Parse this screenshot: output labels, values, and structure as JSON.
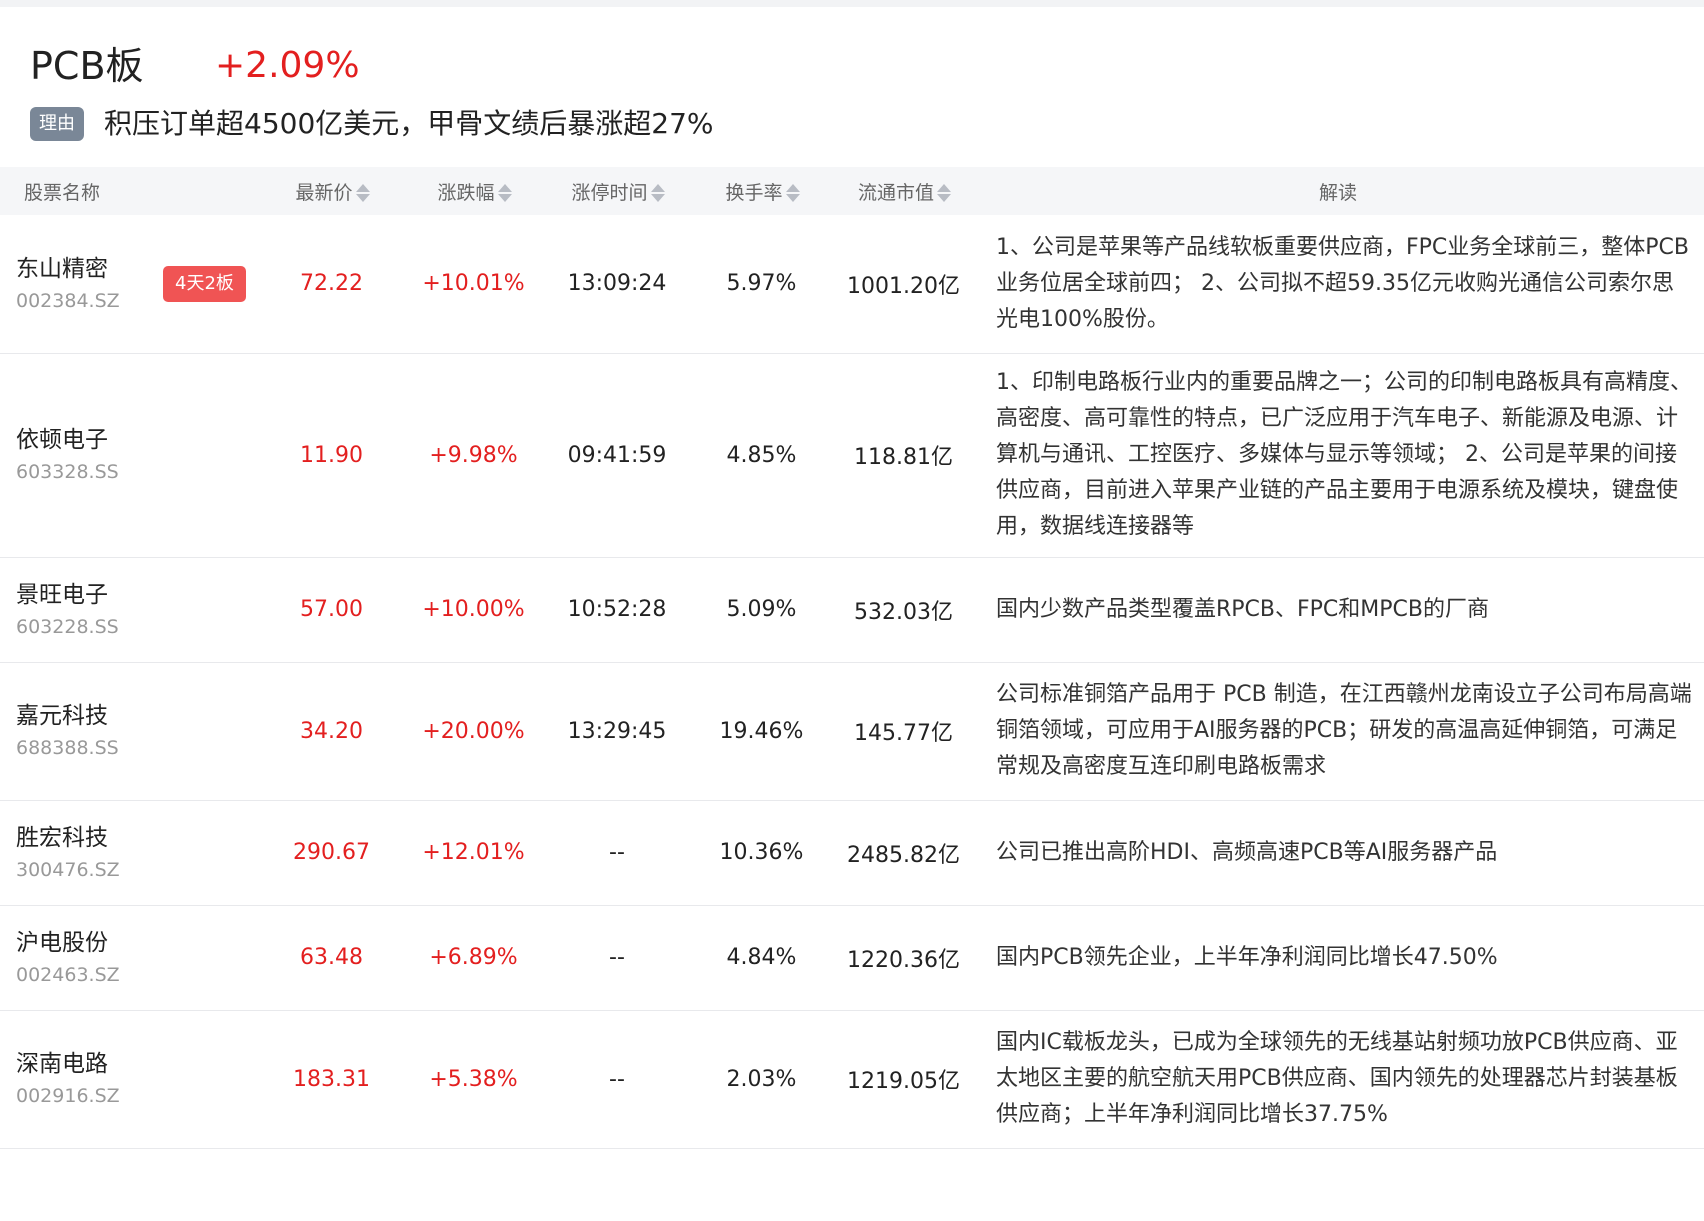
{
  "header": {
    "title": "PCB板",
    "change": "+2.09%",
    "reason_label": "理由",
    "reason_text": "积压订单超4500亿美元，甲骨文绩后暴涨超27%"
  },
  "table": {
    "columns": {
      "name": "股票名称",
      "price": "最新价",
      "change": "涨跌幅",
      "limit_time": "涨停时间",
      "turnover": "换手率",
      "float_cap": "流通市值",
      "interp": "解读"
    },
    "rows": [
      {
        "name": "东山精密",
        "code": "002384.SZ",
        "tag": "4天2板",
        "price": "72.22",
        "change": "+10.01%",
        "limit_time": "13:09:24",
        "turnover": "5.97%",
        "float_cap": "1001.20亿",
        "interp": "1、公司是苹果等产品线软板重要供应商，FPC业务全球前三，整体PCB业务位居全球前四； 2、公司拟不超59.35亿元收购光通信公司索尔思光电100%股份。"
      },
      {
        "name": "依顿电子",
        "code": "603328.SS",
        "tag": "",
        "price": "11.90",
        "change": "+9.98%",
        "limit_time": "09:41:59",
        "turnover": "4.85%",
        "float_cap": "118.81亿",
        "interp": "1、印制电路板行业内的重要品牌之一；公司的印制电路板具有高精度、高密度、高可靠性的特点，已广泛应用于汽车电子、新能源及电源、计算机与通讯、工控医疗、多媒体与显示等领域； 2、公司是苹果的间接供应商，目前进入苹果产业链的产品主要用于电源系统及模块，键盘使用，数据线连接器等"
      },
      {
        "name": "景旺电子",
        "code": "603228.SS",
        "tag": "",
        "price": "57.00",
        "change": "+10.00%",
        "limit_time": "10:52:28",
        "turnover": "5.09%",
        "float_cap": "532.03亿",
        "interp": "国内少数产品类型覆盖RPCB、FPC和MPCB的厂商"
      },
      {
        "name": "嘉元科技",
        "code": "688388.SS",
        "tag": "",
        "price": "34.20",
        "change": "+20.00%",
        "limit_time": "13:29:45",
        "turnover": "19.46%",
        "float_cap": "145.77亿",
        "interp": "公司标准铜箔产品用于 PCB 制造，在江西赣州龙南设立子公司布局高端铜箔领域，可应用于AI服务器的PCB；研发的高温高延伸铜箔，可满足常规及高密度互连印刷电路板需求"
      },
      {
        "name": "胜宏科技",
        "code": "300476.SZ",
        "tag": "",
        "price": "290.67",
        "change": "+12.01%",
        "limit_time": "--",
        "turnover": "10.36%",
        "float_cap": "2485.82亿",
        "interp": "公司已推出高阶HDI、高频高速PCB等AI服务器产品"
      },
      {
        "name": "沪电股份",
        "code": "002463.SZ",
        "tag": "",
        "price": "63.48",
        "change": "+6.89%",
        "limit_time": "--",
        "turnover": "4.84%",
        "float_cap": "1220.36亿",
        "interp": "国内PCB领先企业，上半年净利润同比增长47.50%"
      },
      {
        "name": "深南电路",
        "code": "002916.SZ",
        "tag": "",
        "price": "183.31",
        "change": "+5.38%",
        "limit_time": "--",
        "turnover": "2.03%",
        "float_cap": "1219.05亿",
        "interp": "国内IC载板龙头，已成为全球领先的无线基站射频功放PCB供应商、亚太地区主要的航空航天用PCB供应商、国内领先的处理器芯片封装基板供应商；上半年净利润同比增长37.75%"
      }
    ]
  },
  "colors": {
    "up": "#e31f1f",
    "tag_bg": "#f05454",
    "badge_bg": "#7a8797",
    "header_bg": "#f5f6f8"
  },
  "icons": {
    "sort": "sort-both-icon"
  }
}
